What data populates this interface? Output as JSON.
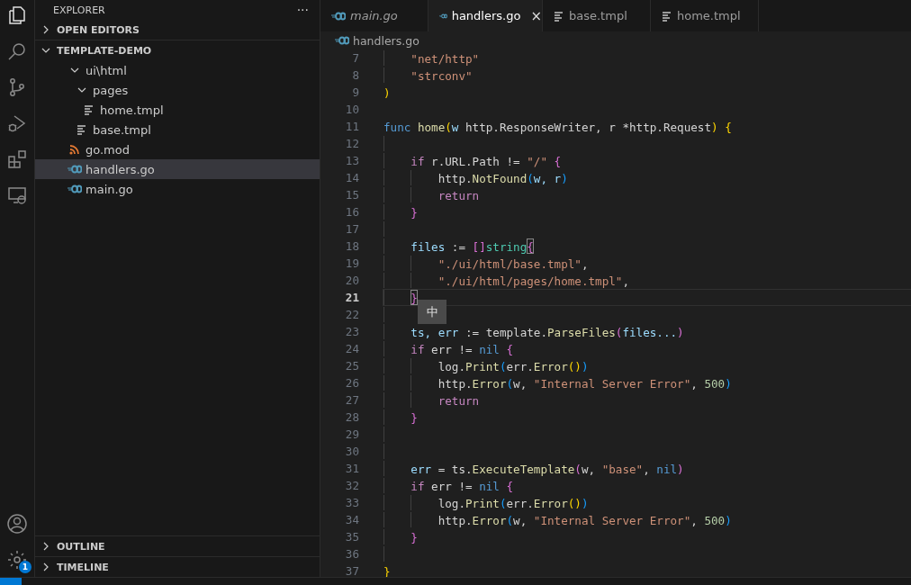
{
  "activity_bar": {
    "items": [
      {
        "kind": "files",
        "selected": true
      },
      {
        "kind": "search",
        "selected": false
      },
      {
        "kind": "source-control",
        "selected": false
      },
      {
        "kind": "run",
        "selected": false
      },
      {
        "kind": "extensions",
        "selected": false
      },
      {
        "kind": "remote",
        "selected": false
      }
    ],
    "settings_badge": "1"
  },
  "sidebar": {
    "title": "EXPLORER",
    "more": "···",
    "sections": [
      {
        "title": "OPEN EDITORS",
        "expanded": false
      },
      {
        "title": "TEMPLATE-DEMO",
        "expanded": true
      }
    ],
    "tree": [
      {
        "label": "ui\\html",
        "kind": "folder",
        "expanded": true,
        "selected": false,
        "children": [
          {
            "label": "pages",
            "kind": "folder",
            "expanded": true,
            "selected": false,
            "children": [
              {
                "label": "home.tmpl",
                "kind": "template",
                "selected": false
              }
            ]
          },
          {
            "label": "base.tmpl",
            "kind": "template",
            "selected": false
          }
        ]
      },
      {
        "label": "go.mod",
        "kind": "gomod",
        "selected": false
      },
      {
        "label": "handlers.go",
        "kind": "go",
        "selected": true
      },
      {
        "label": "main.go",
        "kind": "go",
        "selected": false
      }
    ],
    "bottom_sections": [
      {
        "title": "OUTLINE",
        "expanded": false
      },
      {
        "title": "TIMELINE",
        "expanded": false
      }
    ]
  },
  "tabs": [
    {
      "label": "main.go",
      "kind": "go",
      "selected": false,
      "preview": true
    },
    {
      "label": "handlers.go",
      "kind": "go",
      "selected": true,
      "preview": false,
      "close": "×"
    },
    {
      "label": "base.tmpl",
      "kind": "template",
      "selected": false,
      "preview": false
    },
    {
      "label": "home.tmpl",
      "kind": "template",
      "selected": false,
      "preview": false
    }
  ],
  "breadcrumb": {
    "label": "handlers.go",
    "kind": "go"
  },
  "ime_indicator": "中",
  "lines": [
    {
      "number": "7",
      "current": false,
      "tokens": [
        {
          "kind": "indent"
        },
        {
          "kind": "string",
          "text": "\"net/http\""
        }
      ]
    },
    {
      "number": "8",
      "current": false,
      "tokens": [
        {
          "kind": "indent"
        },
        {
          "kind": "string",
          "text": "\"strconv\""
        }
      ]
    },
    {
      "number": "9",
      "current": false,
      "tokens": [
        {
          "kind": "bracket1",
          "text": ")"
        }
      ]
    },
    {
      "number": "10",
      "current": false
    },
    {
      "number": "11",
      "current": false,
      "tokens": [
        {
          "kind": "keyword",
          "text": "func "
        },
        {
          "kind": "function",
          "text": "home"
        },
        {
          "kind": "bracket1",
          "text": "("
        },
        {
          "kind": "variable",
          "text": "w"
        },
        {
          "kind": "plain",
          "text": " http.ResponseWriter, r *http.Request"
        },
        {
          "kind": "bracket1",
          "text": ")"
        },
        {
          "kind": "bracket1",
          "text": " {"
        }
      ]
    },
    {
      "number": "12",
      "current": false,
      "tokens": [
        {
          "kind": "indent"
        }
      ]
    },
    {
      "number": "13",
      "current": false,
      "tokens": [
        {
          "kind": "indent"
        },
        {
          "kind": "control",
          "text": "if"
        },
        {
          "kind": "plain",
          "text": " r.URL.Path != "
        },
        {
          "kind": "string",
          "text": "\"/\""
        },
        {
          "kind": "bracket2",
          "text": " {"
        }
      ]
    },
    {
      "number": "14",
      "current": false,
      "tokens": [
        {
          "kind": "indent"
        },
        {
          "kind": "indent"
        },
        {
          "kind": "plain",
          "text": "http."
        },
        {
          "kind": "function",
          "text": "NotFound"
        },
        {
          "kind": "bracket3",
          "text": "("
        },
        {
          "kind": "variable",
          "text": "w, r"
        },
        {
          "kind": "bracket3",
          "text": ")"
        }
      ]
    },
    {
      "number": "15",
      "current": false,
      "tokens": [
        {
          "kind": "indent"
        },
        {
          "kind": "indent"
        },
        {
          "kind": "control",
          "text": "return"
        }
      ]
    },
    {
      "number": "16",
      "current": false,
      "tokens": [
        {
          "kind": "indent"
        },
        {
          "kind": "bracket2",
          "text": "}"
        }
      ]
    },
    {
      "number": "17",
      "current": false,
      "tokens": [
        {
          "kind": "indent"
        }
      ]
    },
    {
      "number": "18",
      "current": false,
      "tokens": [
        {
          "kind": "indent"
        },
        {
          "kind": "variable",
          "text": "files"
        },
        {
          "kind": "plain",
          "text": " := "
        },
        {
          "kind": "bracket2",
          "text": "[]"
        },
        {
          "kind": "type",
          "text": "string"
        },
        {
          "kind": "bracket-match",
          "text": "{"
        }
      ]
    },
    {
      "number": "19",
      "current": false,
      "tokens": [
        {
          "kind": "indent"
        },
        {
          "kind": "indent"
        },
        {
          "kind": "string",
          "text": "\"./ui/html/base.tmpl\""
        },
        {
          "kind": "plain",
          "text": ","
        }
      ]
    },
    {
      "number": "20",
      "current": false,
      "tokens": [
        {
          "kind": "indent"
        },
        {
          "kind": "indent"
        },
        {
          "kind": "string",
          "text": "\"./ui/html/pages/home.tmpl\""
        },
        {
          "kind": "plain",
          "text": ","
        }
      ]
    },
    {
      "number": "21",
      "current": true,
      "tokens": [
        {
          "kind": "indent"
        },
        {
          "kind": "bracket-match",
          "text": "}"
        }
      ]
    },
    {
      "number": "22",
      "current": false,
      "tokens": [
        {
          "kind": "indent"
        }
      ]
    },
    {
      "number": "23",
      "current": false,
      "tokens": [
        {
          "kind": "indent"
        },
        {
          "kind": "variable",
          "text": "ts, err"
        },
        {
          "kind": "plain",
          "text": " := template."
        },
        {
          "kind": "function",
          "text": "ParseFiles"
        },
        {
          "kind": "bracket2",
          "text": "("
        },
        {
          "kind": "variable",
          "text": "files..."
        },
        {
          "kind": "bracket2",
          "text": ")"
        }
      ]
    },
    {
      "number": "24",
      "current": false,
      "tokens": [
        {
          "kind": "indent"
        },
        {
          "kind": "control",
          "text": "if"
        },
        {
          "kind": "plain",
          "text": " err != "
        },
        {
          "kind": "keyword",
          "text": "nil"
        },
        {
          "kind": "bracket2",
          "text": " {"
        }
      ]
    },
    {
      "number": "25",
      "current": false,
      "tokens": [
        {
          "kind": "indent"
        },
        {
          "kind": "indent"
        },
        {
          "kind": "plain",
          "text": "log."
        },
        {
          "kind": "function",
          "text": "Print"
        },
        {
          "kind": "bracket3",
          "text": "("
        },
        {
          "kind": "plain",
          "text": "err."
        },
        {
          "kind": "function",
          "text": "Error"
        },
        {
          "kind": "bracket1",
          "text": "()"
        },
        {
          "kind": "bracket3",
          "text": ")"
        }
      ]
    },
    {
      "number": "26",
      "current": false,
      "tokens": [
        {
          "kind": "indent"
        },
        {
          "kind": "indent"
        },
        {
          "kind": "plain",
          "text": "http."
        },
        {
          "kind": "function",
          "text": "Error"
        },
        {
          "kind": "bracket3",
          "text": "("
        },
        {
          "kind": "plain",
          "text": "w, "
        },
        {
          "kind": "string",
          "text": "\"Internal Server Error\""
        },
        {
          "kind": "plain",
          "text": ", "
        },
        {
          "kind": "number",
          "text": "500"
        },
        {
          "kind": "bracket3",
          "text": ")"
        }
      ]
    },
    {
      "number": "27",
      "current": false,
      "tokens": [
        {
          "kind": "indent"
        },
        {
          "kind": "indent"
        },
        {
          "kind": "control",
          "text": "return"
        }
      ]
    },
    {
      "number": "28",
      "current": false,
      "tokens": [
        {
          "kind": "indent"
        },
        {
          "kind": "bracket2",
          "text": "}"
        }
      ]
    },
    {
      "number": "29",
      "current": false,
      "tokens": [
        {
          "kind": "indent"
        }
      ]
    },
    {
      "number": "30",
      "current": false,
      "tokens": [
        {
          "kind": "indent"
        }
      ]
    },
    {
      "number": "31",
      "current": false,
      "tokens": [
        {
          "kind": "indent"
        },
        {
          "kind": "variable",
          "text": "err"
        },
        {
          "kind": "plain",
          "text": " = ts."
        },
        {
          "kind": "function",
          "text": "ExecuteTemplate"
        },
        {
          "kind": "bracket2",
          "text": "("
        },
        {
          "kind": "plain",
          "text": "w, "
        },
        {
          "kind": "string",
          "text": "\"base\""
        },
        {
          "kind": "plain",
          "text": ", "
        },
        {
          "kind": "keyword",
          "text": "nil"
        },
        {
          "kind": "bracket2",
          "text": ")"
        }
      ]
    },
    {
      "number": "32",
      "current": false,
      "tokens": [
        {
          "kind": "indent"
        },
        {
          "kind": "control",
          "text": "if"
        },
        {
          "kind": "plain",
          "text": " err != "
        },
        {
          "kind": "keyword",
          "text": "nil"
        },
        {
          "kind": "bracket2",
          "text": " {"
        }
      ]
    },
    {
      "number": "33",
      "current": false,
      "tokens": [
        {
          "kind": "indent"
        },
        {
          "kind": "indent"
        },
        {
          "kind": "plain",
          "text": "log."
        },
        {
          "kind": "function",
          "text": "Print"
        },
        {
          "kind": "bracket3",
          "text": "("
        },
        {
          "kind": "plain",
          "text": "err."
        },
        {
          "kind": "function",
          "text": "Error"
        },
        {
          "kind": "bracket1",
          "text": "()"
        },
        {
          "kind": "bracket3",
          "text": ")"
        }
      ]
    },
    {
      "number": "34",
      "current": false,
      "tokens": [
        {
          "kind": "indent"
        },
        {
          "kind": "indent"
        },
        {
          "kind": "plain",
          "text": "http."
        },
        {
          "kind": "function",
          "text": "Error"
        },
        {
          "kind": "bracket3",
          "text": "("
        },
        {
          "kind": "plain",
          "text": "w, "
        },
        {
          "kind": "string",
          "text": "\"Internal Server Error\""
        },
        {
          "kind": "plain",
          "text": ", "
        },
        {
          "kind": "number",
          "text": "500"
        },
        {
          "kind": "bracket3",
          "text": ")"
        }
      ]
    },
    {
      "number": "35",
      "current": false,
      "tokens": [
        {
          "kind": "indent"
        },
        {
          "kind": "bracket2",
          "text": "}"
        }
      ]
    },
    {
      "number": "36",
      "current": false,
      "tokens": [
        {
          "kind": "indent"
        }
      ]
    },
    {
      "number": "37",
      "current": false,
      "tokens": [
        {
          "kind": "bracket1",
          "text": "}"
        }
      ]
    }
  ]
}
